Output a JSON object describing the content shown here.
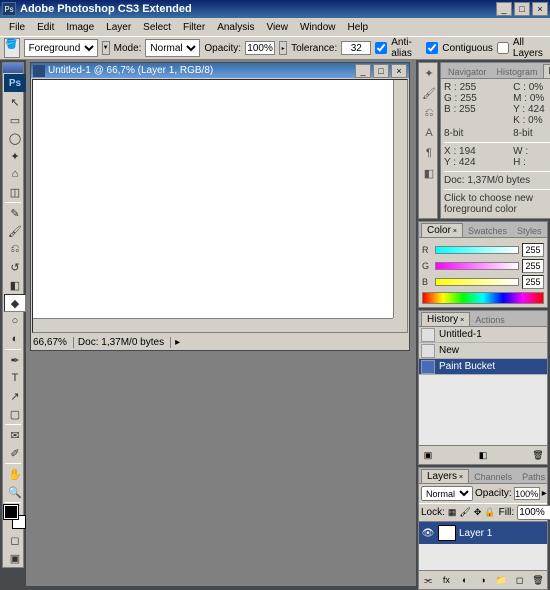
{
  "window": {
    "title": "Adobe Photoshop CS3 Extended",
    "icon_text": "Ps"
  },
  "menu": [
    "File",
    "Edit",
    "Image",
    "Layer",
    "Select",
    "Filter",
    "Analysis",
    "View",
    "Window",
    "Help"
  ],
  "options": {
    "fill_label": "Foreground",
    "mode_label": "Mode:",
    "mode_value": "Normal",
    "opacity_label": "Opacity:",
    "opacity_value": "100%",
    "tolerance_label": "Tolerance:",
    "tolerance_value": "32",
    "antialias": "Anti-alias",
    "contiguous": "Contiguous",
    "all_layers": "All Layers"
  },
  "doc": {
    "title": "Untitled-1 @ 66,7% (Layer 1, RGB/8)",
    "zoom": "66,67%",
    "status": "Doc: 1,37M/0 bytes"
  },
  "panels": {
    "nav_tabs": [
      "Navigator",
      "Histogram",
      "Info"
    ],
    "info": {
      "R": "255",
      "G": "255",
      "B": "255",
      "C": "0%",
      "M": "0%",
      "Y": "424",
      "K": "0%",
      "bit1": "8-bit",
      "bit2": "8-bit",
      "X": "194",
      "W": "",
      "H": "",
      "doc": "Doc: 1,37M/0 bytes",
      "tip": "Click to choose new foreground color"
    },
    "color_tabs": [
      "Color",
      "Swatches",
      "Styles"
    ],
    "color": {
      "R": "255",
      "G": "255",
      "B": "255"
    },
    "history_tabs": [
      "History",
      "Actions"
    ],
    "history": {
      "doc": "Untitled-1",
      "items": [
        "New",
        "Paint Bucket"
      ]
    },
    "layers_tabs": [
      "Layers",
      "Channels",
      "Paths"
    ],
    "layers": {
      "mode": "Normal",
      "opacity_label": "Opacity:",
      "opacity": "100%",
      "lock_label": "Lock:",
      "fill_label": "Fill:",
      "fill": "100%",
      "name": "Layer 1"
    }
  }
}
